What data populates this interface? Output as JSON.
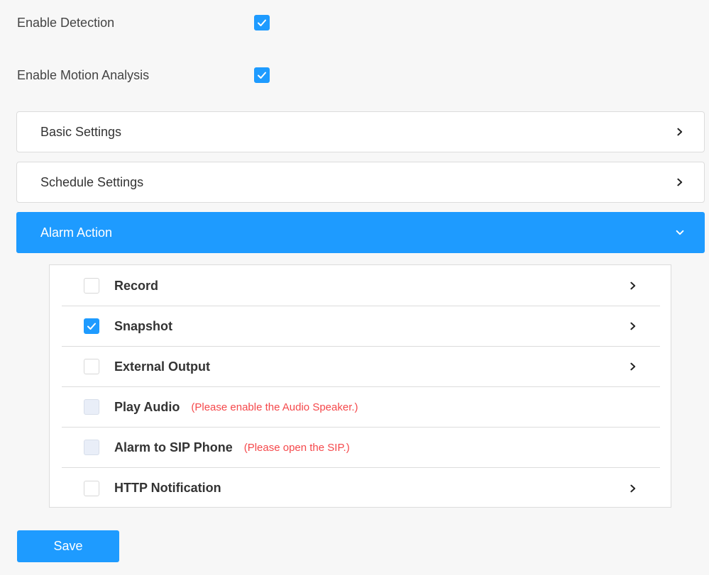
{
  "toggles": [
    {
      "label": "Enable Detection",
      "checked": true
    },
    {
      "label": "Enable Motion Analysis",
      "checked": true
    }
  ],
  "panels": [
    {
      "title": "Basic Settings",
      "state": "collapsed",
      "icon": "chevron-right-icon"
    },
    {
      "title": "Schedule Settings",
      "state": "collapsed",
      "icon": "chevron-right-icon"
    },
    {
      "title": "Alarm Action",
      "state": "expanded",
      "icon": "chevron-down-icon"
    }
  ],
  "alarm_actions": [
    {
      "label": "Record",
      "checked": false,
      "disabled": false,
      "note": "",
      "has_chevron": true
    },
    {
      "label": "Snapshot",
      "checked": true,
      "disabled": false,
      "note": "",
      "has_chevron": true
    },
    {
      "label": "External Output",
      "checked": false,
      "disabled": false,
      "note": "",
      "has_chevron": true
    },
    {
      "label": "Play Audio",
      "checked": false,
      "disabled": true,
      "note": "(Please enable the Audio Speaker.)",
      "has_chevron": false
    },
    {
      "label": "Alarm to SIP Phone",
      "checked": false,
      "disabled": true,
      "note": "(Please open the SIP.)",
      "has_chevron": false
    },
    {
      "label": "HTTP Notification",
      "checked": false,
      "disabled": false,
      "note": "",
      "has_chevron": true
    }
  ],
  "save_label": "Save",
  "colors": {
    "accent": "#1e9bff",
    "warning_text": "#f5484b",
    "border": "#dcdcdc",
    "background": "#f7f7f7"
  }
}
